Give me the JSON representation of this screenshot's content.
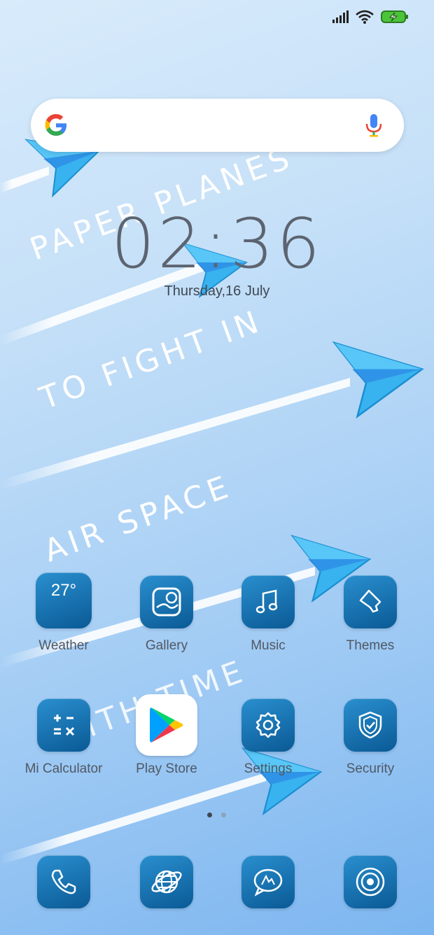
{
  "status": {
    "signal": "signal-icon",
    "wifi": "wifi-icon",
    "battery": "battery-charging-icon"
  },
  "wallpaper": {
    "lines": [
      "PAPER PLANES",
      "TO FIGHT IN",
      "AIR SPACE",
      "WITH TIME"
    ]
  },
  "search": {
    "logo": "google-icon",
    "mic": "mic-icon"
  },
  "clock": {
    "time": "02:36",
    "date": "Thursday,16 July"
  },
  "apps_row1": [
    {
      "label": "Weather",
      "icon": "weather-icon",
      "temp": "27°"
    },
    {
      "label": "Gallery",
      "icon": "gallery-icon"
    },
    {
      "label": "Music",
      "icon": "music-icon"
    },
    {
      "label": "Themes",
      "icon": "themes-icon"
    }
  ],
  "apps_row2": [
    {
      "label": "Mi Calculator",
      "icon": "calculator-icon"
    },
    {
      "label": "Play Store",
      "icon": "play-store-icon"
    },
    {
      "label": "Settings",
      "icon": "gear-icon"
    },
    {
      "label": "Security",
      "icon": "shield-icon"
    }
  ],
  "pager": {
    "pages": 2,
    "current": 1
  },
  "dock": [
    {
      "icon": "phone-icon"
    },
    {
      "icon": "browser-icon"
    },
    {
      "icon": "messages-icon"
    },
    {
      "icon": "camera-icon"
    }
  ],
  "colors": {
    "icon_blue": "#0a5a95",
    "plane_blue": "#3ab6f2"
  }
}
